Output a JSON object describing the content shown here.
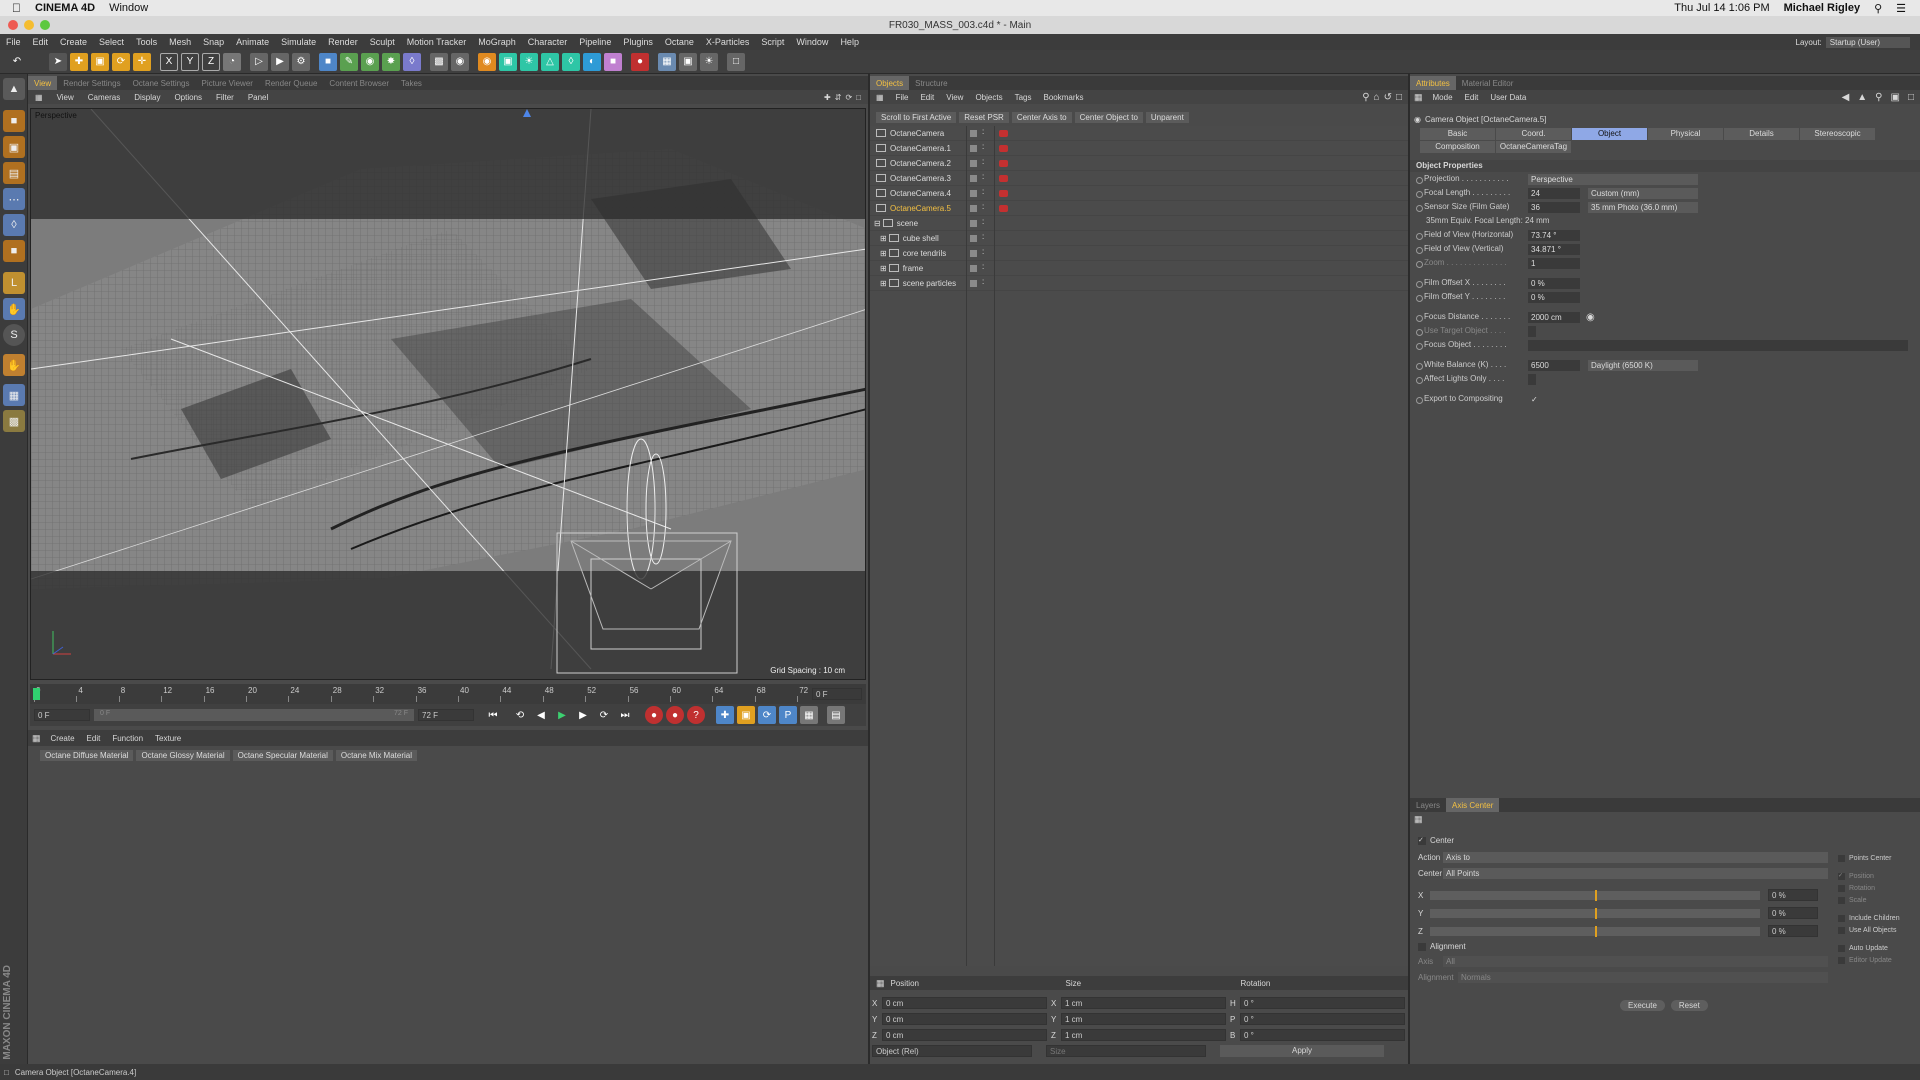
{
  "macbar": {
    "app": "CINEMA 4D",
    "menu": "Window",
    "datetime": "Thu Jul 14  1:06 PM",
    "user": "Michael Rigley"
  },
  "window": {
    "title": "FR030_MASS_003.c4d * - Main",
    "layout_label": "Layout:",
    "layout_value": "Startup (User)"
  },
  "menu": [
    "File",
    "Edit",
    "Create",
    "Select",
    "Tools",
    "Mesh",
    "Snap",
    "Animate",
    "Simulate",
    "Render",
    "Sculpt",
    "Motion Tracker",
    "MoGraph",
    "Character",
    "Pipeline",
    "Plugins",
    "Octane",
    "X-Particles",
    "Script",
    "Window",
    "Help"
  ],
  "viewport": {
    "tabs": [
      "View",
      "Render Settings",
      "Octane Settings",
      "Picture Viewer",
      "Render Queue",
      "Content Browser",
      "Takes"
    ],
    "menu": [
      "View",
      "Cameras",
      "Display",
      "Options",
      "Filter",
      "Panel"
    ],
    "label": "Perspective",
    "grid_spacing": "Grid Spacing : 10 cm"
  },
  "timeline": {
    "ticks": [
      "0",
      "4",
      "8",
      "12",
      "16",
      "20",
      "24",
      "28",
      "32",
      "36",
      "40",
      "44",
      "48",
      "52",
      "56",
      "60",
      "64",
      "68",
      "72"
    ],
    "current": "0 F",
    "start": "0 F",
    "range_start": "0 F",
    "range_end": "72 F",
    "end": "72 F"
  },
  "material": {
    "menu": [
      "Create",
      "Edit",
      "Function",
      "Texture"
    ],
    "buttons": [
      "Octane Diffuse Material",
      "Octane Glossy Material",
      "Octane Specular Material",
      "Octane Mix Material"
    ]
  },
  "objects": {
    "tabs": [
      "Objects",
      "Structure"
    ],
    "menu": [
      "File",
      "Edit",
      "View",
      "Objects",
      "Tags",
      "Bookmarks"
    ],
    "buttons": [
      "Scroll to First Active",
      "Reset PSR",
      "Center Axis to",
      "Center Object to",
      "Unparent"
    ],
    "items": [
      {
        "name": "OctaneCamera",
        "active": false,
        "indent": 0
      },
      {
        "name": "OctaneCamera.1",
        "active": false,
        "indent": 0
      },
      {
        "name": "OctaneCamera.2",
        "active": false,
        "indent": 0
      },
      {
        "name": "OctaneCamera.3",
        "active": false,
        "indent": 0
      },
      {
        "name": "OctaneCamera.4",
        "active": false,
        "indent": 0
      },
      {
        "name": "OctaneCamera.5",
        "active": true,
        "indent": 0
      },
      {
        "name": "scene",
        "active": false,
        "indent": 0
      },
      {
        "name": "cube shell",
        "active": false,
        "indent": 1
      },
      {
        "name": "core tendrils",
        "active": false,
        "indent": 1
      },
      {
        "name": "frame",
        "active": false,
        "indent": 1
      },
      {
        "name": "scene particles",
        "active": false,
        "indent": 1
      }
    ]
  },
  "coords": {
    "headers": [
      "Position",
      "Size",
      "Rotation"
    ],
    "rows": [
      {
        "axis": "X",
        "pos": "0 cm",
        "sizeaxis": "X",
        "size": "1 cm",
        "rotaxis": "H",
        "rot": "0 °"
      },
      {
        "axis": "Y",
        "pos": "0 cm",
        "sizeaxis": "Y",
        "size": "1 cm",
        "rotaxis": "P",
        "rot": "0 °"
      },
      {
        "axis": "Z",
        "pos": "0 cm",
        "sizeaxis": "Z",
        "size": "1 cm",
        "rotaxis": "B",
        "rot": "0 °"
      }
    ],
    "mode": "Object (Rel)",
    "size_mode": "Size",
    "apply": "Apply"
  },
  "attributes": {
    "tabs": [
      "Attributes",
      "Material Editor"
    ],
    "menu": [
      "Mode",
      "Edit",
      "User Data"
    ],
    "header": "Camera Object [OctaneCamera.5]",
    "pages_row1": [
      "Basic",
      "Coord.",
      "Object",
      "Physical",
      "Details",
      "Stereoscopic"
    ],
    "pages_row2": [
      "Composition",
      "OctaneCameraTag"
    ],
    "active_page": "Object",
    "section": "Object Properties",
    "props": [
      {
        "label": "Projection . . . . . . . . . . .",
        "value": "",
        "dropdown": "Perspective"
      },
      {
        "label": "Focal Length . . . . . . . . .",
        "value": "24",
        "dropdown": "Custom (mm)"
      },
      {
        "label": "Sensor Size (Film Gate)",
        "value": "36",
        "dropdown": "35 mm Photo (36.0 mm)"
      },
      {
        "label": "35mm Equiv. Focal Length: 24 mm",
        "value": "",
        "dropdown": ""
      },
      {
        "label": "Field of View (Horizontal)",
        "value": "73.74 °",
        "dropdown": ""
      },
      {
        "label": "Field of View (Vertical)",
        "value": "34.871 °",
        "dropdown": ""
      },
      {
        "label": "Zoom . . . . . . . . . . . . . .",
        "value": "1",
        "dropdown": ""
      },
      {
        "label": "Film Offset X . . . . . . . .",
        "value": "0 %",
        "dropdown": ""
      },
      {
        "label": "Film Offset Y . . . . . . . .",
        "value": "0 %",
        "dropdown": ""
      },
      {
        "label": "Focus Distance . . . . . . .",
        "value": "2000 cm",
        "dropdown": ""
      },
      {
        "label": "Use Target Object . . . .",
        "value": "",
        "dropdown": ""
      },
      {
        "label": "Focus Object . . . . . . . .",
        "value": "",
        "dropdown": ""
      },
      {
        "label": "White Balance (K) . . . .",
        "value": "6500",
        "dropdown": "Daylight (6500 K)"
      },
      {
        "label": "Affect Lights Only . . . .",
        "value": "",
        "dropdown": ""
      },
      {
        "label": "Export to Compositing",
        "value": "✓",
        "dropdown": ""
      }
    ]
  },
  "axis": {
    "tabs": [
      "Layers",
      "Axis Center"
    ],
    "center": "Center",
    "action_label": "Action",
    "action_value": "Axis to",
    "center_label": "Center",
    "center_value": "All Points",
    "sliders": [
      {
        "axis": "X",
        "value": "0 %"
      },
      {
        "axis": "Y",
        "value": "0 %"
      },
      {
        "axis": "Z",
        "value": "0 %"
      }
    ],
    "alignment": "Alignment",
    "axis_label": "Axis",
    "axis_value": "All",
    "alignment_label": "Alignment",
    "alignment_value": "Normals",
    "right_options": [
      "Points Center",
      "Position",
      "Rotation",
      "Scale",
      "Include Children",
      "Use All Objects",
      "Auto Update",
      "Editor Update"
    ],
    "execute": "Execute",
    "reset": "Reset"
  },
  "status": "Camera Object [OctaneCamera.4]",
  "brand": "MAXON CINEMA 4D"
}
